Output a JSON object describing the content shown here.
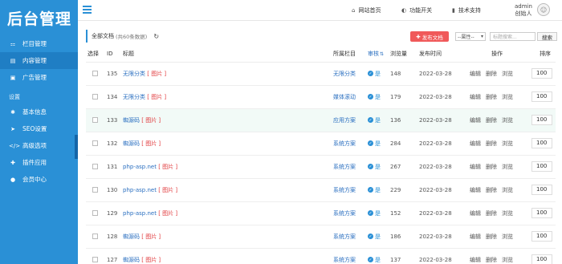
{
  "sidebar": {
    "logo": "后台管理",
    "items_top": [
      {
        "label": "栏目管理",
        "icon": "sitemap-icon",
        "glyph": "⚏"
      },
      {
        "label": "内容管理",
        "icon": "file-icon",
        "glyph": "▤",
        "active": true
      },
      {
        "label": "广告管理",
        "icon": "image-icon",
        "glyph": "▣"
      }
    ],
    "section_label": "设置",
    "items_settings": [
      {
        "label": "基本信息",
        "icon": "gear-icon",
        "glyph": "✱"
      },
      {
        "label": "SEO设置",
        "icon": "rocket-icon",
        "glyph": "➤"
      },
      {
        "label": "高级选项",
        "icon": "code-icon",
        "glyph": "</>"
      },
      {
        "label": "插件应用",
        "icon": "puzzle-icon",
        "glyph": "✚"
      },
      {
        "label": "会员中心",
        "icon": "user-icon",
        "glyph": "●"
      }
    ]
  },
  "topbar": {
    "links": [
      {
        "label": "网站首页",
        "icon": "home-icon",
        "glyph": "⌂"
      },
      {
        "label": "功能开关",
        "icon": "toggle-icon",
        "glyph": "◐"
      },
      {
        "label": "技术支持",
        "icon": "book-icon",
        "glyph": "▮"
      }
    ],
    "user_name": "admin",
    "user_role": "创始人"
  },
  "toolbar": {
    "title": "全部文档",
    "count": "(共60条数据)",
    "publish": "发布文档",
    "attr_select": "--属性--",
    "search_placeholder": "标题搜索...",
    "search_button": "搜索"
  },
  "table": {
    "headers": {
      "select": "选择",
      "id": "ID",
      "title": "标题",
      "column": "所属栏目",
      "audit": "审核",
      "views": "浏览量",
      "date": "发布时间",
      "ops": "操作",
      "sort": "排序"
    },
    "ops": {
      "edit": "编辑",
      "delete": "删除",
      "browse": "浏览"
    },
    "rows": [
      {
        "id": "135",
        "title": "无限分类",
        "tag": "[ 图片 ]",
        "column": "无限分类",
        "audit": "是",
        "views": "148",
        "date": "2022-03-28",
        "sort": "100",
        "column_link": true
      },
      {
        "id": "134",
        "title": "无限分类",
        "tag": "[ 图片 ]",
        "column": "媒体滚动",
        "audit": "是",
        "views": "179",
        "date": "2022-03-28",
        "sort": "100"
      },
      {
        "id": "133",
        "title": "蜘源码",
        "tag": "[ 图片 ]",
        "column": "应用方案",
        "audit": "是",
        "views": "136",
        "date": "2022-03-28",
        "sort": "100",
        "highlight": true
      },
      {
        "id": "132",
        "title": "蜘源码",
        "tag": "[ 图片 ]",
        "column": "系统方案",
        "audit": "是",
        "views": "284",
        "date": "2022-03-28",
        "sort": "100"
      },
      {
        "id": "131",
        "title": "php-asp.net",
        "tag": "[ 图片 ]",
        "column": "系统方案",
        "audit": "是",
        "views": "267",
        "date": "2022-03-28",
        "sort": "100"
      },
      {
        "id": "130",
        "title": "php-asp.net",
        "tag": "[ 图片 ]",
        "column": "系统方案",
        "audit": "是",
        "views": "229",
        "date": "2022-03-28",
        "sort": "100"
      },
      {
        "id": "129",
        "title": "php-asp.net",
        "tag": "[ 图片 ]",
        "column": "系统方案",
        "audit": "是",
        "views": "152",
        "date": "2022-03-28",
        "sort": "100"
      },
      {
        "id": "128",
        "title": "蜘源码",
        "tag": "[ 图片 ]",
        "column": "系统方案",
        "audit": "是",
        "views": "186",
        "date": "2022-03-28",
        "sort": "100"
      },
      {
        "id": "127",
        "title": "蜘源码",
        "tag": "[ 图片 ]",
        "column": "系统方案",
        "audit": "是",
        "views": "137",
        "date": "2022-03-28",
        "sort": "100"
      }
    ]
  }
}
